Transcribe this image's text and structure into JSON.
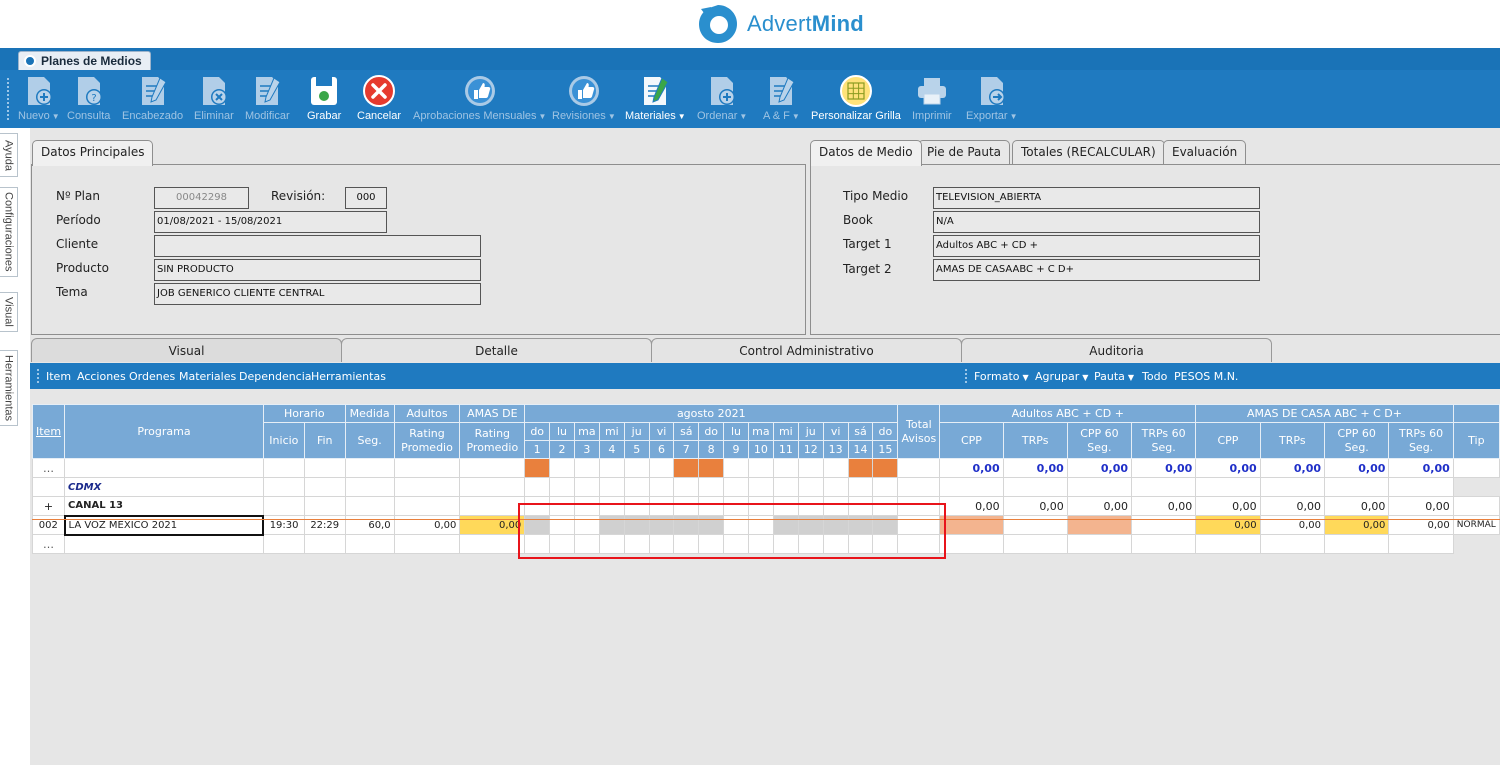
{
  "brand": {
    "name_light": "Advert",
    "name_bold": "Mind",
    "color": "#2a8fce"
  },
  "app_tab": {
    "label": "Planes de Medios"
  },
  "toolbar": [
    {
      "id": "nuevo",
      "label": "Nuevo",
      "caret": true,
      "enabled": false,
      "icon": "doc-plus-icon"
    },
    {
      "id": "consulta",
      "label": "Consulta",
      "caret": false,
      "enabled": false,
      "icon": "doc-question-icon"
    },
    {
      "id": "encabezado",
      "label": "Encabezado",
      "caret": false,
      "enabled": false,
      "icon": "doc-pencil-icon"
    },
    {
      "id": "eliminar",
      "label": "Eliminar",
      "caret": false,
      "enabled": false,
      "icon": "doc-x-icon"
    },
    {
      "id": "modificar",
      "label": "Modificar",
      "caret": false,
      "enabled": false,
      "icon": "doc-edit-icon"
    },
    {
      "id": "grabar",
      "label": "Grabar",
      "caret": false,
      "enabled": true,
      "icon": "save-icon"
    },
    {
      "id": "cancelar",
      "label": "Cancelar",
      "caret": false,
      "enabled": true,
      "icon": "cancel-icon"
    },
    {
      "id": "aprobaciones",
      "label": "Aprobaciones Mensuales",
      "caret": true,
      "enabled": false,
      "icon": "thumbs-up-icon"
    },
    {
      "id": "revisiones",
      "label": "Revisiones",
      "caret": true,
      "enabled": false,
      "icon": "thumbs-up-icon"
    },
    {
      "id": "materiales",
      "label": "Materiales",
      "caret": true,
      "enabled": true,
      "icon": "doc-pencil-icon"
    },
    {
      "id": "ordenar",
      "label": "Ordenar",
      "caret": true,
      "enabled": false,
      "icon": "doc-plus-icon"
    },
    {
      "id": "ayf",
      "label": "A & F",
      "caret": true,
      "enabled": false,
      "icon": "doc-pencil-icon"
    },
    {
      "id": "personalizar",
      "label": "Personalizar Grilla",
      "caret": false,
      "enabled": true,
      "icon": "grid-icon"
    },
    {
      "id": "imprimir",
      "label": "Imprimir",
      "caret": false,
      "enabled": false,
      "icon": "printer-icon"
    },
    {
      "id": "exportar",
      "label": "Exportar",
      "caret": true,
      "enabled": false,
      "icon": "doc-export-icon"
    }
  ],
  "side_tabs": [
    "Ayuda",
    "Configuraciones",
    "Visual",
    "Herramientas"
  ],
  "datos_principales": {
    "tab": "Datos Principales",
    "plan_label": "Nº Plan",
    "plan_value": "00042298",
    "revision_label": "Revisión:",
    "revision_value": "000",
    "periodo_label": "Período",
    "periodo_value": "01/08/2021 - 15/08/2021",
    "cliente_label": "Cliente",
    "cliente_value": "",
    "producto_label": "Producto",
    "producto_value": "SIN PRODUCTO",
    "tema_label": "Tema",
    "tema_value": "JOB GENERICO CLIENTE CENTRAL"
  },
  "right_tabs": [
    "Datos de Medio",
    "Pie de Pauta",
    "Totales (RECALCULAR)",
    "Evaluación"
  ],
  "datos_medio": {
    "tipo_label": "Tipo Medio",
    "tipo_value": "TELEVISION_ABIERTA",
    "book_label": "Book",
    "book_value": "N/A",
    "t1_label": "Target 1",
    "t1_value": "Adultos ABC + CD +",
    "t2_label": "Target 2",
    "t2_value": "AMAS DE CASAABC + C D+"
  },
  "lower_tabs": [
    "Visual",
    "Detalle",
    "Control Administrativo",
    "Auditoria"
  ],
  "menubar_left": [
    "Item",
    "Acciones",
    "Ordenes",
    "Materiales",
    "Dependencia",
    "Herramientas"
  ],
  "menubar_right": [
    {
      "label": "Formato",
      "caret": true
    },
    {
      "label": "Agrupar",
      "caret": true
    },
    {
      "label": "Pauta",
      "caret": true
    },
    {
      "label": "Todo",
      "caret": false
    },
    {
      "label": "PESOS M.N.",
      "caret": false
    }
  ],
  "grid": {
    "h_item": "Item",
    "h_programa": "Programa",
    "h_horario": "Horario",
    "h_medida": "Medida",
    "h_adultos": "Adultos",
    "h_amas": "AMAS DE",
    "h_month": "agosto 2021",
    "h_total": "Total Avisos",
    "h_t1": "Adultos ABC + CD +",
    "h_t2": "AMAS DE CASA ABC + C D+",
    "h_inicio": "Inicio",
    "h_fin": "Fin",
    "h_seg": "Seg.",
    "h_rating": "Rating Promedio",
    "h_cpp": "CPP",
    "h_trps": "TRPs",
    "h_cpp60": "CPP 60 Seg.",
    "h_trps60": "TRPs 60 Seg.",
    "h_tip": "Tip",
    "days": [
      "do",
      "lu",
      "ma",
      "mi",
      "ju",
      "vi",
      "sá",
      "do",
      "lu",
      "ma",
      "mi",
      "ju",
      "vi",
      "sá",
      "do"
    ],
    "dates": [
      "1",
      "2",
      "3",
      "4",
      "5",
      "6",
      "7",
      "8",
      "9",
      "10",
      "11",
      "12",
      "13",
      "14",
      "15"
    ],
    "weekend_idx": [
      0,
      6,
      7,
      13,
      14
    ],
    "zero": "0,00",
    "row_dots": "…",
    "region": "CDMX",
    "group_sign": "+",
    "group_name": "CANAL 13",
    "row_item": "002",
    "row_programa": "LA VOZ MEXICO 2021",
    "row_inicio": "19:30",
    "row_fin": "22:29",
    "row_seg": "60,0",
    "row_tip": "NORMAL",
    "row_gray_idx": [
      0,
      3,
      4,
      5,
      6,
      7,
      10,
      11,
      12,
      13,
      14
    ]
  }
}
